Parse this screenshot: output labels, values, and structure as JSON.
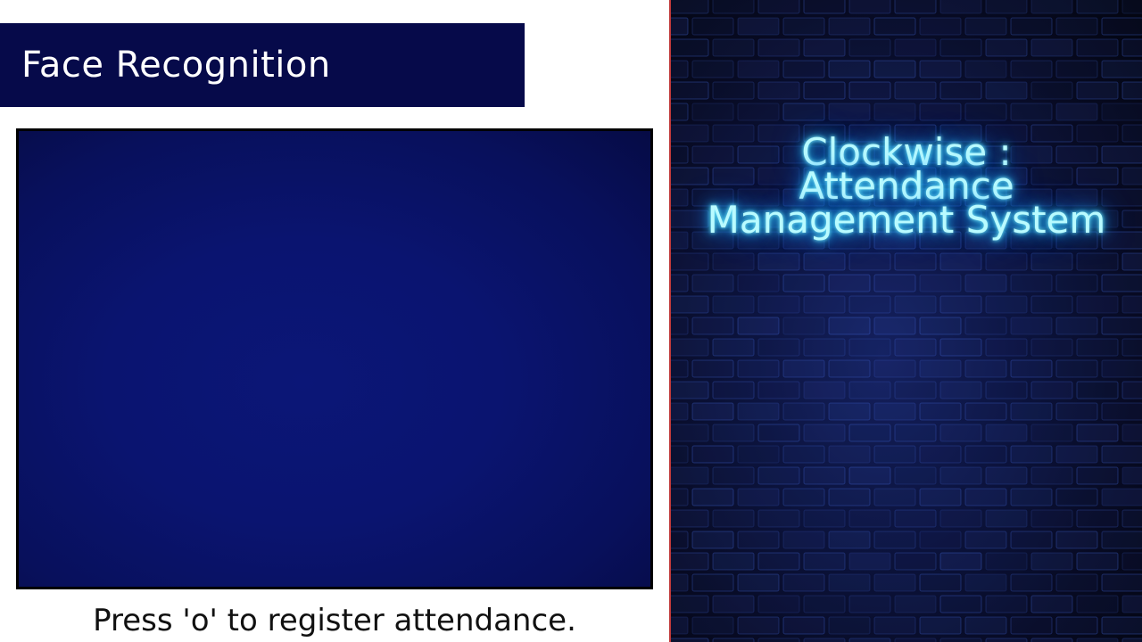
{
  "left_panel": {
    "title": "Face Recognition",
    "instruction": "Press 'o' to register attendance."
  },
  "right_panel": {
    "neon_title_lines": [
      "Clockwise :",
      "Attendance",
      "Management System"
    ]
  },
  "colors": {
    "title_bar_bg": "#060a4a",
    "camera_view_bg": "#0a1470",
    "divider": "#c03a3a",
    "neon_text": "#b9fbff",
    "neon_glow": "#2fd6ff"
  },
  "icons": []
}
